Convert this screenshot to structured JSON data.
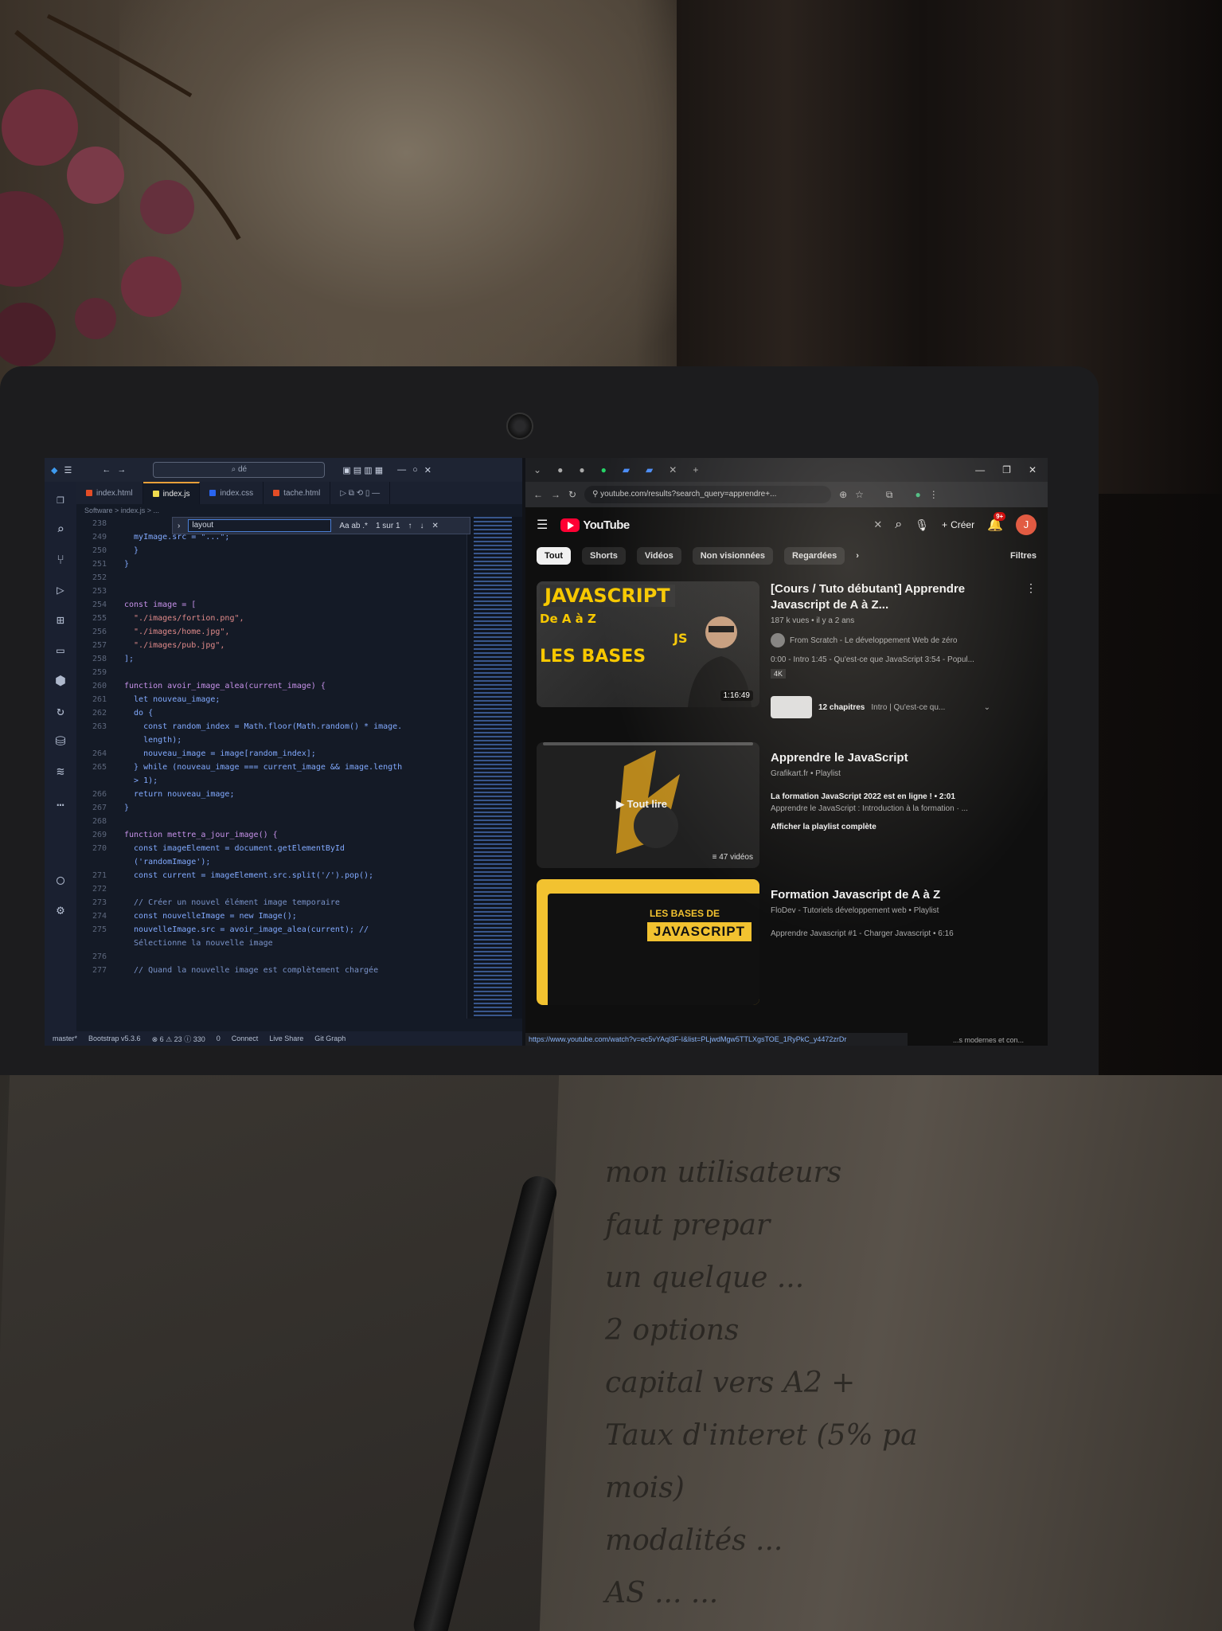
{
  "vscode": {
    "search_text": "dé",
    "tabs": [
      {
        "label": "index.html",
        "color": "#e44d26",
        "active": false
      },
      {
        "label": "index.js",
        "color": "#f0db4f",
        "active": true
      },
      {
        "label": "index.css",
        "color": "#2965f1",
        "active": false
      },
      {
        "label": "tache.html",
        "color": "#e44d26",
        "active": false
      }
    ],
    "breadcrumb": "Software > index.js > ...",
    "find": {
      "query": "layout",
      "count": "1 sur 1"
    },
    "line_numbers": [
      "238",
      "249",
      "250",
      "251",
      "252",
      "253",
      "254",
      "255",
      "256",
      "257",
      "258",
      "259",
      "260",
      "261",
      "262",
      "263",
      "",
      "264",
      "265",
      "",
      "266",
      "267",
      "268",
      "269",
      "270",
      "",
      "271",
      "272",
      "273",
      "274",
      "275",
      "",
      "276",
      "277"
    ],
    "code_lines": [
      "",
      "  myImage.src = \"...\";",
      "  }",
      "}",
      "",
      "",
      "const image = [",
      "  \"./images/fortion.png\",",
      "  \"./images/home.jpg\",",
      "  \"./images/pub.jpg\",",
      "];",
      "",
      "function avoir_image_alea(current_image) {",
      "  let nouveau_image;",
      "  do {",
      "    const random_index = Math.floor(Math.random() * image.",
      "    length);",
      "    nouveau_image = image[random_index];",
      "  } while (nouveau_image === current_image && image.length",
      "  > 1);",
      "  return nouveau_image;",
      "}",
      "",
      "function mettre_a_jour_image() {",
      "  const imageElement = document.getElementById",
      "  ('randomImage');",
      "  const current = imageElement.src.split('/').pop();",
      "",
      "  // Créer un nouvel élément image temporaire",
      "  const nouvelleImage = new Image();",
      "  nouvelleImage.src = avoir_image_alea(current); //",
      "  Sélectionne la nouvelle image",
      "",
      "  // Quand la nouvelle image est complètement chargée"
    ],
    "status": [
      "master*",
      "Bootstrap v5.3.6",
      "⊗ 6 ⚠ 23 ⓘ 330",
      "0",
      "Connect",
      "Live Share",
      "Git Graph"
    ]
  },
  "browser": {
    "url": "youtube.com/results?search_query=apprendre+...",
    "youtube": {
      "logo": "YouTube",
      "create_label": "Créer",
      "notification_count": "9+",
      "avatar_letter": "J",
      "chips": [
        "Tout",
        "Shorts",
        "Vidéos",
        "Non visionnées",
        "Regardées"
      ],
      "filters_label": "Filtres",
      "results": [
        {
          "type": "video",
          "thumb_lines": [
            "JAVASCRIPT",
            "De A à Z",
            "LES BASES"
          ],
          "thumb_js": "JS",
          "duration": "1:16:49",
          "title": "[Cours / Tuto débutant] Apprendre Javascript de A à Z...",
          "sub": "187 k vues • il y a 2 ans",
          "channel": "From Scratch - Le développement Web de zéro",
          "desc": "0:00 - Intro 1:45 - Qu'est-ce que JavaScript 3:54 - Popul...",
          "badge": "4K",
          "chapters_label": "12 chapitres",
          "chapters_desc": "Intro | Qu'est-ce qu..."
        },
        {
          "type": "playlist",
          "play_label": "Tout lire",
          "count": "47 vidéos",
          "title": "Apprendre le JavaScript",
          "sub": "Grafikart.fr • Playlist",
          "desc_strong": "La formation JavaScript 2022 est en ligne ! • 2:01",
          "desc": "Apprendre le JavaScript : Introduction à la formation · ...",
          "link": "Afficher la playlist complète"
        },
        {
          "type": "playlist",
          "thumb_top": "LES BASES DE",
          "thumb_main": "JAVASCRIPT",
          "title": "Formation Javascript de A à Z",
          "sub": "FloDev - Tutoriels développement web • Playlist",
          "desc": "Apprendre Javascript #1 - Charger Javascript • 6:16"
        }
      ]
    },
    "status_url": "https://www.youtube.com/watch?v=ec5vYAql3F-I&list=PLjwdMgw5TTLXgsTOE_1RyPkC_y4472zrDr",
    "status_tail": "...s modernes et con..."
  },
  "notebook": {
    "lines": [
      "mon utilisateurs",
      "faut prepar",
      "un quelque ...",
      "2 options",
      "capital vers A2 +",
      "Taux d'interet (5% pa",
      "mois)",
      "modalités ...",
      "AS ... ..."
    ]
  }
}
